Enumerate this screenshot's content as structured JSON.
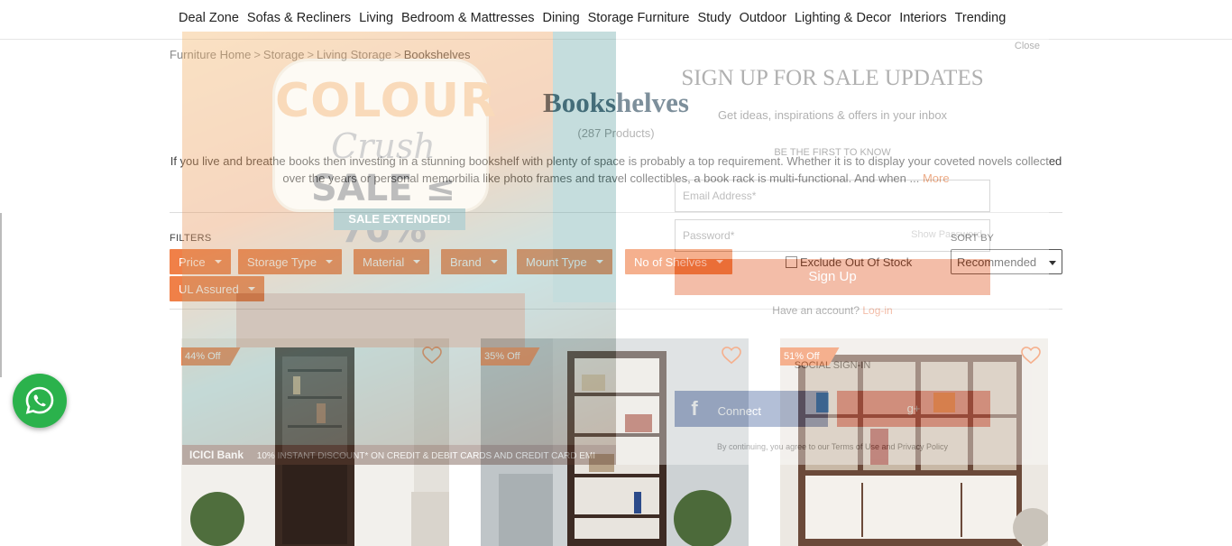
{
  "nav": {
    "items": [
      "Deal Zone",
      "Sofas & Recliners",
      "Living",
      "Bedroom & Mattresses",
      "Dining",
      "Storage Furniture",
      "Study",
      "Outdoor",
      "Lighting & Decor",
      "Interiors",
      "Trending"
    ]
  },
  "breadcrumb": {
    "items": [
      "Furniture Home",
      "Storage",
      "Living Storage"
    ],
    "current": "Bookshelves",
    "separator": ">"
  },
  "page": {
    "title": "Bookshelves",
    "count": "(287 Products)",
    "description": "If you live and breathe books then investing in a stunning bookshelf with plenty of space is probably a top requirement. Whether it is to display your coveted novels collected over the years or personal memorbilia like photo frames and travel collectibles, a book rack is multi-functional. And when ...",
    "more_label": "More"
  },
  "filters": {
    "label": "FILTERS",
    "buttons": [
      "Price",
      "Storage Type",
      "Material",
      "Brand",
      "Mount Type",
      "No of Shelves",
      "UL Assured"
    ],
    "exclude_label": "Exclude Out Of Stock",
    "exclude_checked": false
  },
  "sort": {
    "label": "SORT BY",
    "selected": "Recommended"
  },
  "products": [
    {
      "discount": "44% Off"
    },
    {
      "discount": "35% Off"
    },
    {
      "discount": "51% Off"
    }
  ],
  "popup": {
    "close_label": "Close",
    "promo_colour": "COLOUR",
    "promo_crush": "Crush",
    "promo_sale": "SALE ≤ 70%",
    "promo_extended": "SALE EXTENDED!",
    "promo_bank": "ICICI Bank",
    "promo_bank_offer": "10% INSTANT DISCOUNT* ON CREDIT & DEBIT CARDS AND CREDIT CARD EMI",
    "heading": "SIGN UP FOR SALE UPDATES",
    "subheading": "Get ideas, inspirations & offers in your inbox",
    "first_label": "BE THE FIRST TO KNOW",
    "email_placeholder": "Email Address*",
    "password_placeholder": "Password*",
    "show_password": "Show Password",
    "signup_button": "Sign Up",
    "have_account": "Have an account?",
    "login_link": "Log-in",
    "social_label": "SOCIAL SIGN-IN",
    "facebook_label": "Connect",
    "terms": "By continuing, you agree to our Terms of Use and Privacy Policy"
  },
  "colors": {
    "accent": "#f08048",
    "title": "#2d4a5e",
    "whatsapp": "#2bb24c"
  }
}
